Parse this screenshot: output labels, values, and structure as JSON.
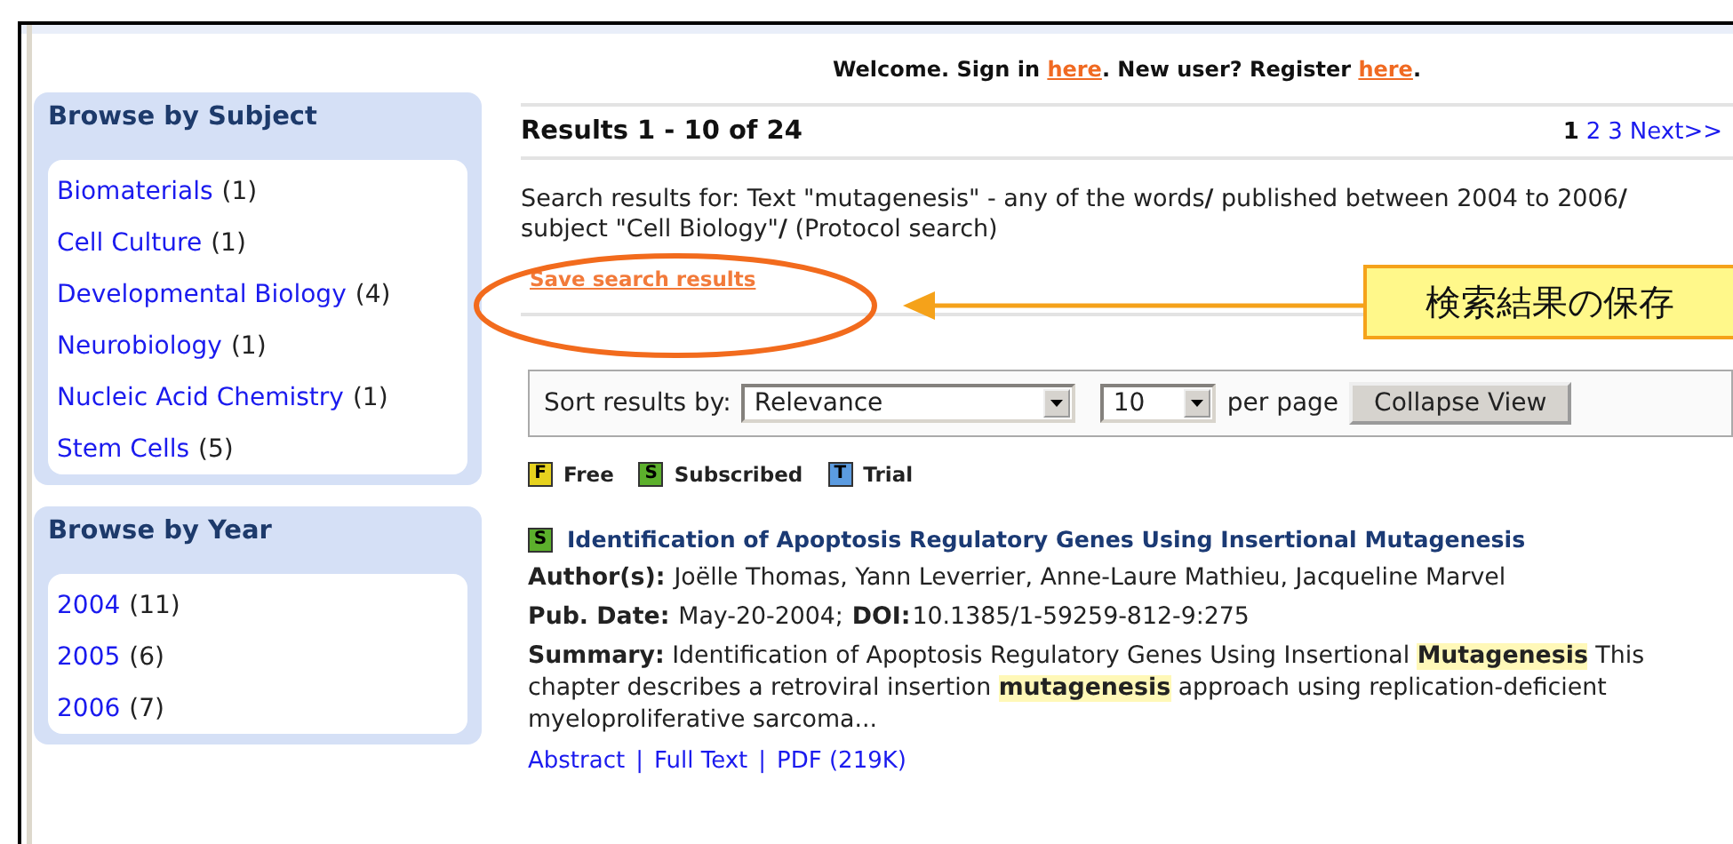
{
  "header": {
    "welcome": [
      {
        "kind": "text",
        "text": "Welcome. Sign in "
      },
      {
        "kind": "link",
        "text": "here"
      },
      {
        "kind": "text",
        "text": ". New user? Register "
      },
      {
        "kind": "link",
        "text": "here"
      },
      {
        "kind": "text",
        "text": "."
      }
    ]
  },
  "sidebar": [
    {
      "title": "Browse by Subject",
      "items": [
        {
          "label": "Biomaterials",
          "count": "(1)"
        },
        {
          "label": "Cell Culture",
          "count": "(1)"
        },
        {
          "label": "Developmental Biology",
          "count": "(4)"
        },
        {
          "label": "Neurobiology",
          "count": "(1)"
        },
        {
          "label": "Nucleic Acid Chemistry",
          "count": "(1)"
        },
        {
          "label": "Stem Cells",
          "count": "(5)"
        }
      ]
    },
    {
      "title": "Browse by Year",
      "items": [
        {
          "label": "2004",
          "count": "(11)"
        },
        {
          "label": "2005",
          "count": "(6)"
        },
        {
          "label": "2006",
          "count": "(7)"
        }
      ]
    }
  ],
  "results": {
    "heading": "Results 1 - 10 of 24",
    "pages": [
      {
        "label": "1",
        "selected": true
      },
      {
        "label": "2",
        "selected": false
      },
      {
        "label": "3",
        "selected": false
      }
    ],
    "next": "Next>>"
  },
  "query": "Search results for: Text \"mutagenesis\" - any of the words**/** published between 2004 to 2006**/** subject \"Cell Biology\"**/** (Protocol search)",
  "save_link": "Save search results",
  "callout": {
    "text": "検索結果の保存"
  },
  "sort": {
    "label": "Sort results by:",
    "value": "Relevance",
    "per_page_value": "10",
    "per_page_label": "per page",
    "button": "Collapse View"
  },
  "legend": [
    {
      "letter": "F",
      "label": "Free",
      "color": "#e6d21e"
    },
    {
      "letter": "S",
      "label": "Subscribed",
      "color": "#5cb02c"
    },
    {
      "letter": "T",
      "label": "Trial",
      "color": "#5b9be0"
    }
  ],
  "items": [
    {
      "badge": "S",
      "color": "#5cb02c",
      "title": "Identification of Apoptosis Regulatory Genes Using Insertional Mutagenesis",
      "authors_label": "Author(s):",
      "authors": "Joëlle Thomas, Yann Leverrier, Anne-Laure Mathieu, Jacqueline Marvel",
      "date_label": "Pub. Date:",
      "date": "May-20-2004;",
      "doi_label": "DOI:",
      "doi": "10.1385/1-59259-812-9:275",
      "summary_label": "Summary:",
      "summary": "Identification of Apoptosis Regulatory Genes Using Insertional **Mutagenesis** This chapter describes a retroviral insertion **mutagenesis** approach using replication-deficient myeloproliferative sarcoma...",
      "links": [
        "Abstract",
        "Full Text",
        "PDF (219K)"
      ],
      "separator": "|"
    }
  ]
}
